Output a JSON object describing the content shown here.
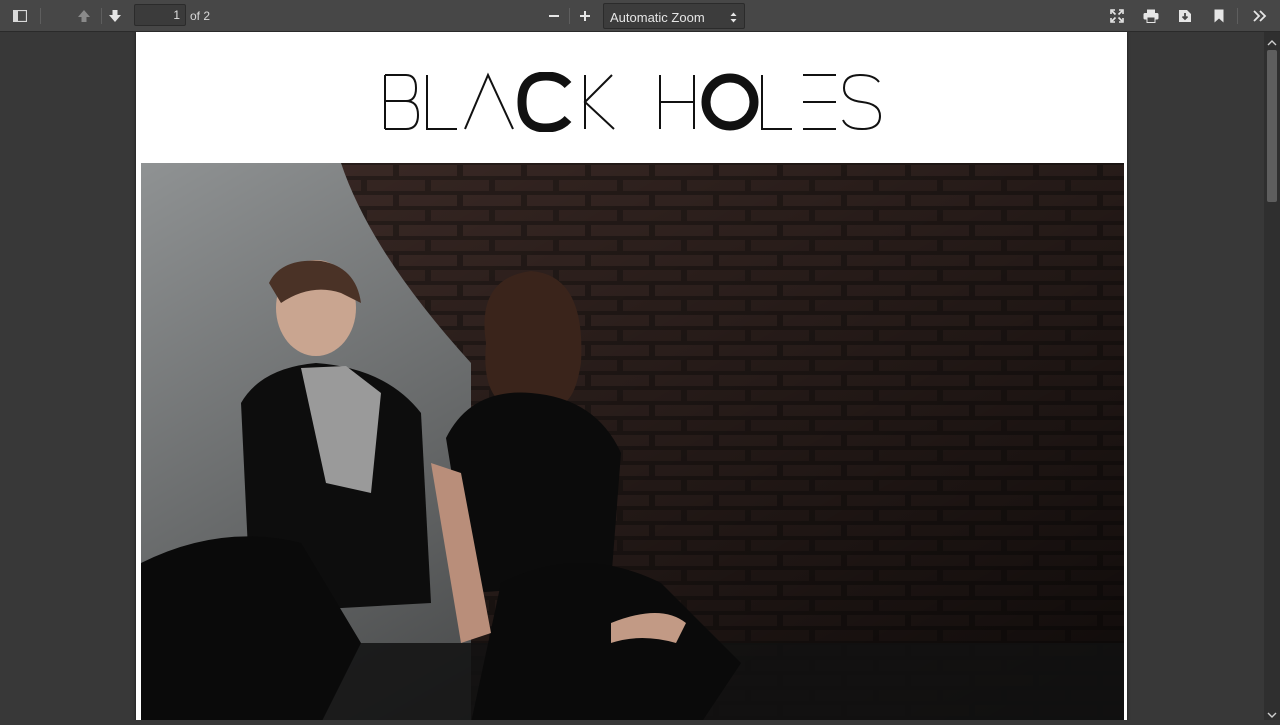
{
  "toolbar": {
    "page_number": "1",
    "page_count_label": "of 2",
    "zoom_label": "Automatic Zoom"
  },
  "icons": {
    "sidebar": "sidebar-toggle-icon",
    "prev": "previous-page-icon",
    "next": "next-page-icon",
    "zoom_out": "zoom-out-icon",
    "zoom_in": "zoom-in-icon",
    "fullscreen": "presentation-mode-icon",
    "print": "print-icon",
    "download": "download-icon",
    "bookmark": "bookmark-icon",
    "tools": "tools-chevron-icon"
  },
  "document": {
    "title_text": "BLACK HOLES",
    "photo_alt": "band-photo"
  },
  "colors": {
    "toolbar_bg": "#474747",
    "viewer_bg": "#383838",
    "page_bg": "#ffffff"
  }
}
